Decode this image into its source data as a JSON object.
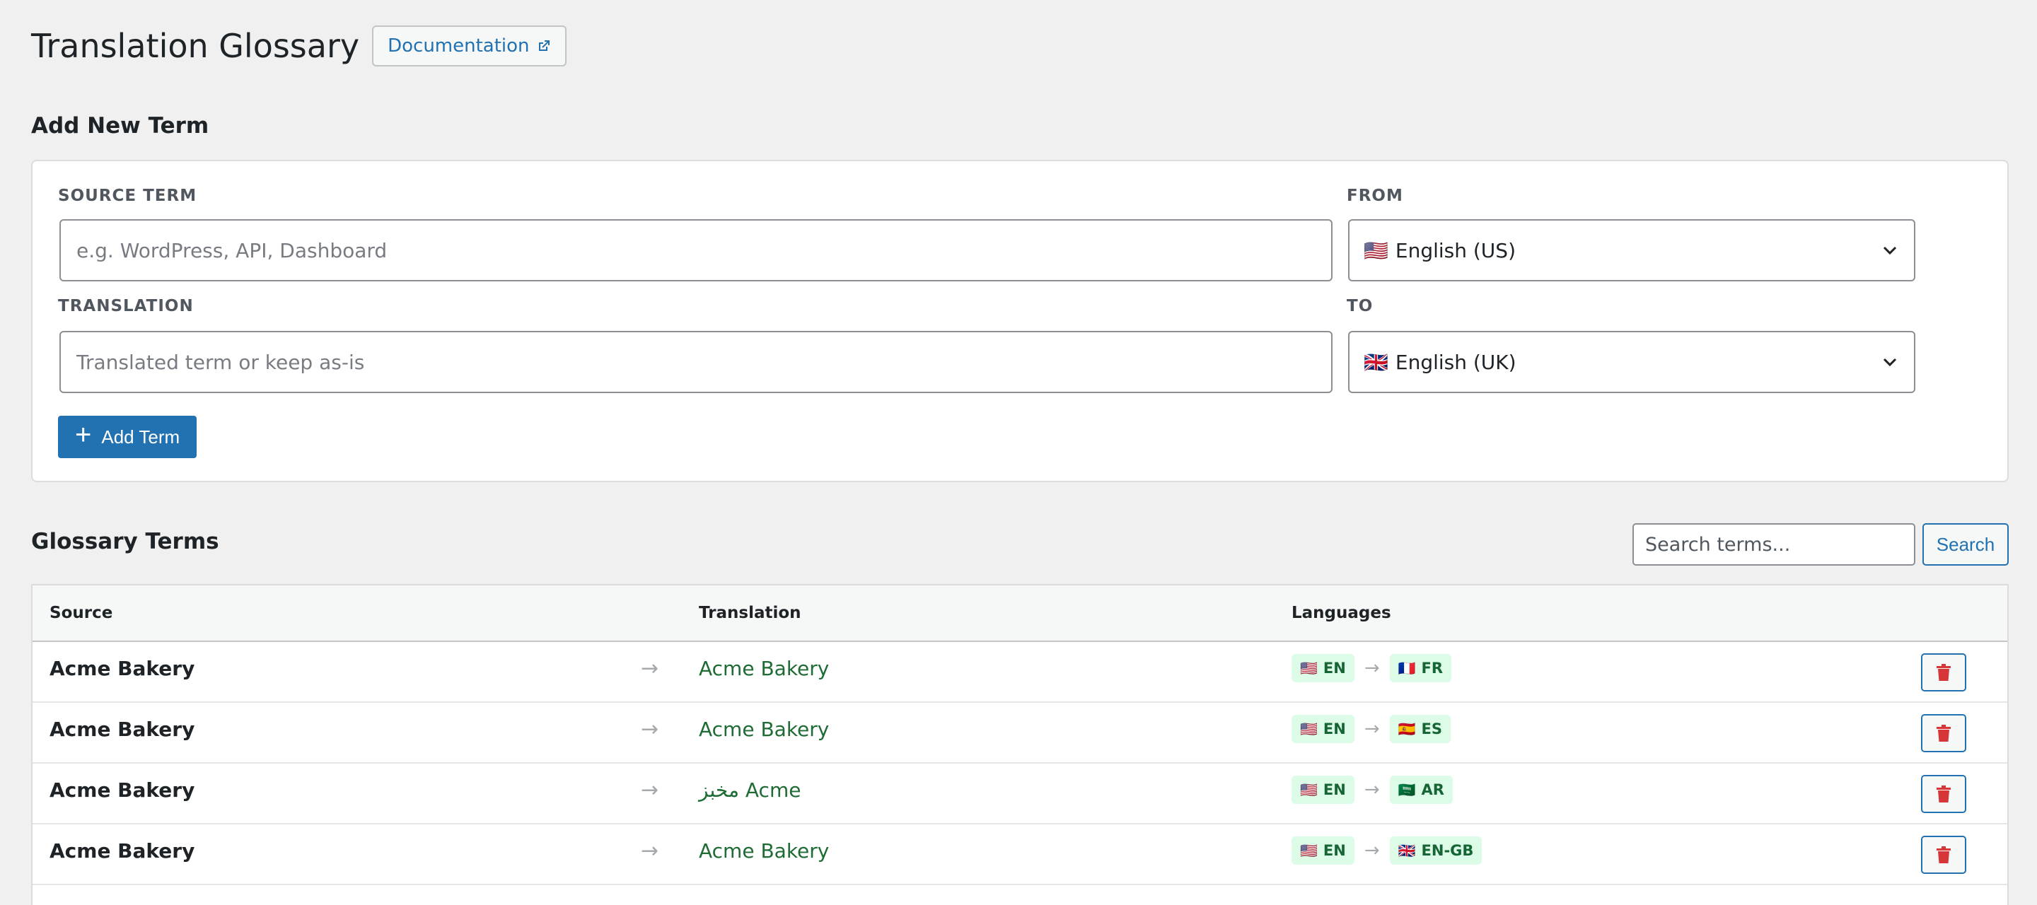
{
  "header": {
    "title": "Translation Glossary",
    "documentation_label": "Documentation"
  },
  "add_term": {
    "section_title": "Add New Term",
    "source_label": "SOURCE TERM",
    "source_placeholder": "e.g. WordPress, API, Dashboard",
    "from_label": "FROM",
    "from_flag": "🇺🇸",
    "from_value": "English (US)",
    "translation_label": "TRANSLATION",
    "translation_placeholder": "Translated term or keep as-is",
    "to_label": "TO",
    "to_flag": "🇬🇧",
    "to_value": "English (UK)",
    "add_button_label": "Add Term"
  },
  "glossary": {
    "section_title": "Glossary Terms",
    "search_placeholder": "Search terms...",
    "search_button_label": "Search",
    "columns": {
      "source": "Source",
      "translation": "Translation",
      "languages": "Languages"
    },
    "rows": [
      {
        "source": "Acme Bakery",
        "arrow": "→",
        "translation": "Acme Bakery",
        "from_flag": "🇺🇸",
        "from_code": "EN",
        "lang_arrow": "→",
        "to_flag": "🇫🇷",
        "to_code": "FR"
      },
      {
        "source": "Acme Bakery",
        "arrow": "→",
        "translation": "Acme Bakery",
        "from_flag": "🇺🇸",
        "from_code": "EN",
        "lang_arrow": "→",
        "to_flag": "🇪🇸",
        "to_code": "ES"
      },
      {
        "source": "Acme Bakery",
        "arrow": "→",
        "translation": "مخبز Acme",
        "from_flag": "🇺🇸",
        "from_code": "EN",
        "lang_arrow": "→",
        "to_flag": "🇸🇦",
        "to_code": "AR"
      },
      {
        "source": "Acme Bakery",
        "arrow": "→",
        "translation": "Acme Bakery",
        "from_flag": "🇺🇸",
        "from_code": "EN",
        "lang_arrow": "→",
        "to_flag": "🇬🇧",
        "to_code": "EN-GB"
      }
    ]
  },
  "colors": {
    "accent": "#2271b1",
    "translation_text": "#1e6b34",
    "badge_bg": "#dcfce7",
    "delete_icon": "#d63638"
  },
  "icons": {
    "documentation": "external-link-icon",
    "add": "plus-icon",
    "select": "chevron-down-icon",
    "delete": "trash-icon"
  }
}
